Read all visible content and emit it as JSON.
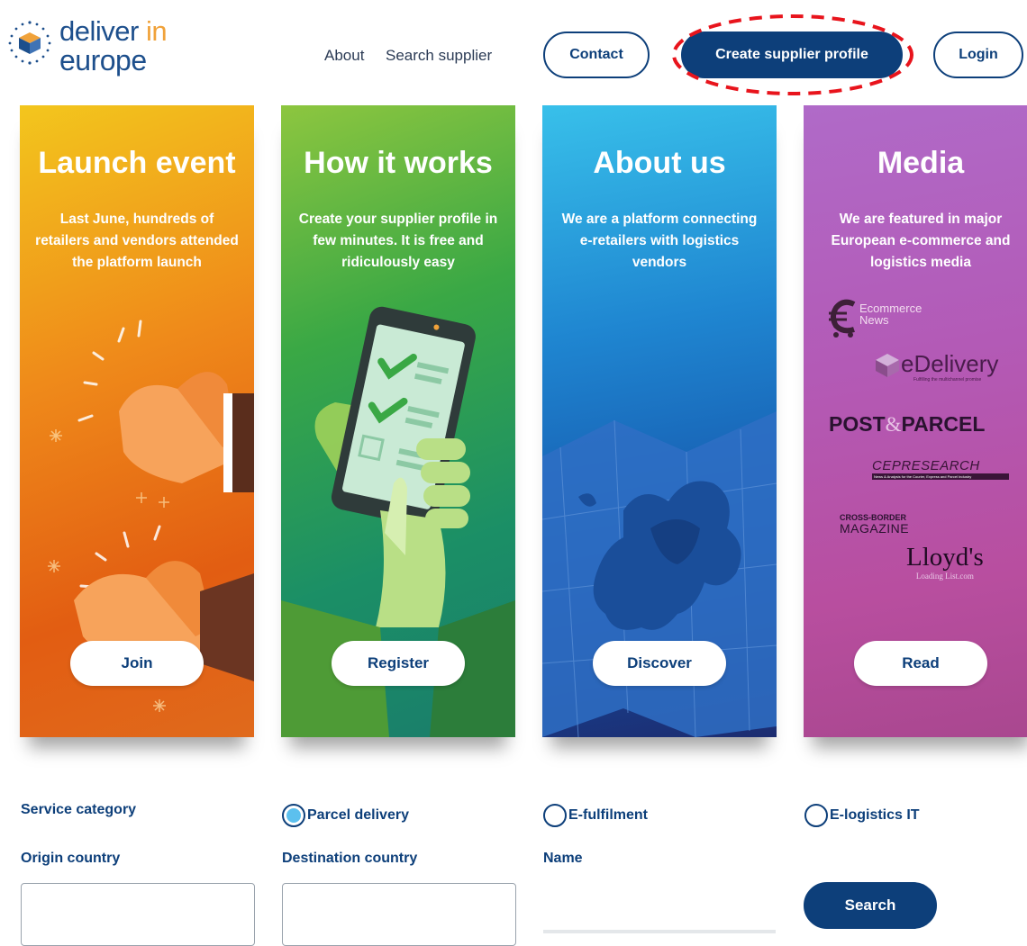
{
  "header": {
    "logo": {
      "line1_main": "deliver",
      "line1_accent": "in",
      "line2": "europe"
    },
    "nav": {
      "about": "About",
      "search_supplier": "Search supplier"
    },
    "contact_label": "Contact",
    "create_profile_label": "Create supplier profile",
    "login_label": "Login"
  },
  "cards": [
    {
      "title": "Launch event",
      "text": "Last June, hundreds of retailers and vendors attended the platform launch",
      "button": "Join"
    },
    {
      "title": "How it works",
      "text": "Create your supplier profile in few minutes. It is free and ridiculously easy",
      "button": "Register"
    },
    {
      "title": "About us",
      "text": "We are a platform connecting e-retailers with logistics vendors",
      "button": "Discover"
    },
    {
      "title": "Media",
      "text": "We are featured in major European e-commerce and logistics media",
      "button": "Read"
    }
  ],
  "media_logos": {
    "ecommerce_news": {
      "line1": "Ecommerce",
      "line2": "News"
    },
    "edelivery": {
      "name": "eDelivery",
      "tagline": "Fulfilling the multichannel promise"
    },
    "post_parcel": {
      "left": "POST",
      "amp": "&",
      "right": "PARCEL"
    },
    "cep_research": {
      "name": "CEPRESEARCH",
      "tagline": "News & Analysis for the Courier, Express and Parcel Industry"
    },
    "cross_border": {
      "line1": "CROSS-BORDER",
      "line2": "MAGAZINE"
    },
    "lloyds": {
      "name": "Lloyd's",
      "tagline": "Loading List.com"
    }
  },
  "search_form": {
    "service_category_label": "Service category",
    "options": [
      {
        "label": "Parcel delivery",
        "selected": true
      },
      {
        "label": "E-fulfilment",
        "selected": false
      },
      {
        "label": "E-logistics IT",
        "selected": false
      }
    ],
    "origin_label": "Origin country",
    "destination_label": "Destination country",
    "name_label": "Name",
    "search_button": "Search"
  },
  "colors": {
    "brand_navy": "#0d3f7a",
    "logo_accent": "#f0a23a",
    "highlight_red": "#e8141c",
    "radio_selected": "#5cc0ee"
  }
}
